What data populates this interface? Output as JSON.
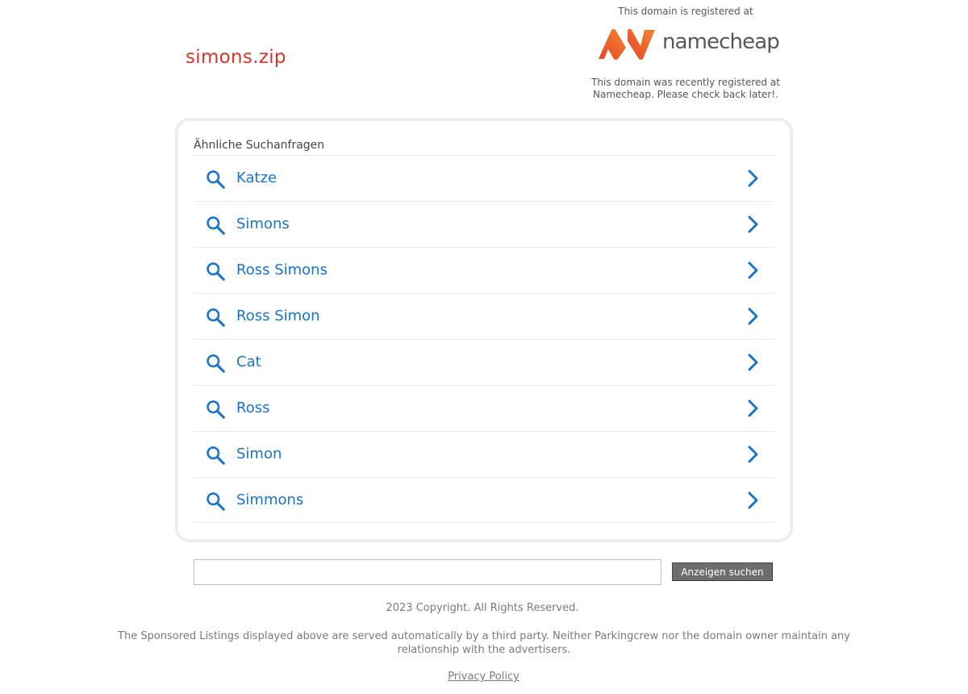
{
  "header": {
    "domain": "simons.zip"
  },
  "registrar": {
    "top_text": "This domain is registered at",
    "logo_name": "namecheap",
    "logo_colors": [
      "#e44427",
      "#f58633"
    ],
    "bottom_line1": "This domain was recently registered at",
    "bottom_line2": "Namecheap. Please check back later!."
  },
  "results": {
    "heading": "Ähnliche Suchanfragen",
    "link_color": "#1a73c9",
    "items": [
      {
        "label": "Katze"
      },
      {
        "label": "Simons"
      },
      {
        "label": "Ross Simons"
      },
      {
        "label": "Ross Simon"
      },
      {
        "label": "Cat"
      },
      {
        "label": "Ross"
      },
      {
        "label": "Simon"
      },
      {
        "label": "Simmons"
      }
    ]
  },
  "search": {
    "value": "",
    "button_label": "Anzeigen suchen"
  },
  "footer": {
    "copyright": "2023 Copyright. All Rights Reserved.",
    "disclaimer": "The Sponsored Listings displayed above are served automatically by a third party. Neither Parkingcrew nor the domain owner maintain any relationship with the advertisers.",
    "privacy_label": "Privacy Policy"
  }
}
